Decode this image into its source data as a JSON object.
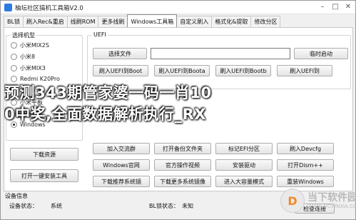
{
  "window": {
    "title": "柚坛社区搞机工具箱V2.0"
  },
  "tabs": [
    {
      "label": "BL锁"
    },
    {
      "label": "刷入Rec&重启"
    },
    {
      "label": "线刷ROM"
    },
    {
      "label": "更多线刷"
    },
    {
      "label": "Windows工具箱"
    },
    {
      "label": "自定义刷入"
    },
    {
      "label": "格式化&提取"
    },
    {
      "label": "修改分区"
    }
  ],
  "model_group": {
    "label": "选择机型",
    "options": [
      {
        "label": "小米MIX2S",
        "checked": false
      },
      {
        "label": "小米8",
        "checked": false
      },
      {
        "label": "小米MIX3",
        "checked": false
      },
      {
        "label": "Redmi K20Pro",
        "checked": false
      },
      {
        "label": "小米9",
        "checked": false
      },
      {
        "label": "小米平板",
        "checked": false
      }
    ],
    "download_label": "下载站点",
    "download_option": {
      "label": "Windows",
      "checked": true
    }
  },
  "left_buttons": {
    "download_resources": "下载资源",
    "open_install_tool": "打开一键安装工具"
  },
  "uefi_group": {
    "label": "UEFI",
    "select_file": "选择文件",
    "temp_boot": "临时启动",
    "row1": [
      "刷入UEFI到Boot",
      "刷入UEFI到Boota",
      "刷入UEFI到Bootb",
      "刷入UEFI到"
    ]
  },
  "grid_buttons": {
    "row_a": [
      "加入交流群",
      "打开备份文件夹",
      "标记EFI分区",
      "刷入Devcfg"
    ],
    "row_b": [
      "Windows官网",
      "官方操作视频",
      "安装驱动",
      "打开Dism++"
    ],
    "row_c": [
      "下载推荐系统镜",
      "下载更多系统镜像",
      "进入大容量模式",
      "重装Windows"
    ]
  },
  "device_info": {
    "label": "设备信息",
    "status_label": "设备状态：",
    "status_value": "系统",
    "bl_label": "BL锁状态：",
    "bl_value": "未知",
    "check_button": "检查连接"
  },
  "overlay": {
    "line1": "预测343期管家婆一码一肖10",
    "line2": "0中奖,全面数据解析执行_RX"
  },
  "watermark": {
    "name": "当下软件园",
    "url": "WWW.DOWNXIA.COM",
    "logo_char": "D"
  },
  "colors": {
    "app_icon": "#2d7be0",
    "watermark_accent": "#f08a2c"
  }
}
